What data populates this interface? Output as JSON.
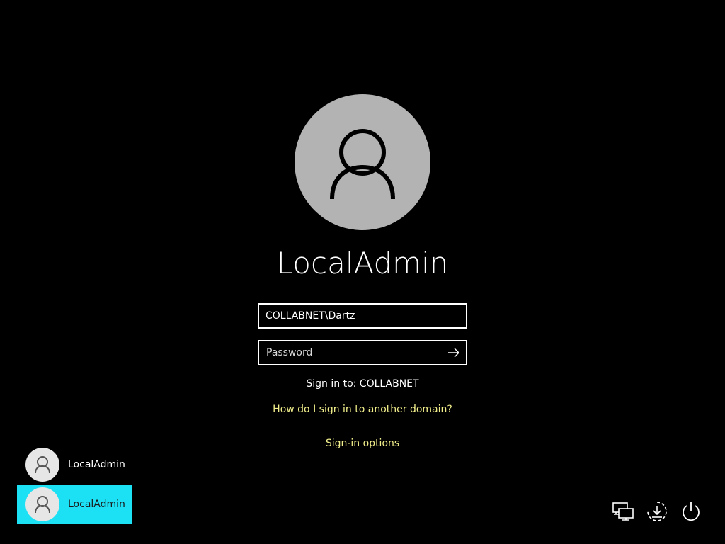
{
  "account": {
    "display_name": "LocalAdmin"
  },
  "form": {
    "username_value": "COLLABNET\\Dartz",
    "password_placeholder": "Password",
    "sign_in_to": "Sign in to: COLLABNET",
    "other_domain_link": "How do I sign in to another domain?",
    "sign_in_options_link": "Sign-in options"
  },
  "user_list": [
    {
      "name": "LocalAdmin",
      "selected": false
    },
    {
      "name": "LocalAdmin",
      "selected": true
    }
  ],
  "corner_icons": [
    "network-icon",
    "ease-of-access-icon",
    "power-icon"
  ],
  "colors": {
    "background": "#000000",
    "avatar": "#b3b3b3",
    "link": "#f3f08c",
    "selected_tile": "#1ce1f5"
  }
}
